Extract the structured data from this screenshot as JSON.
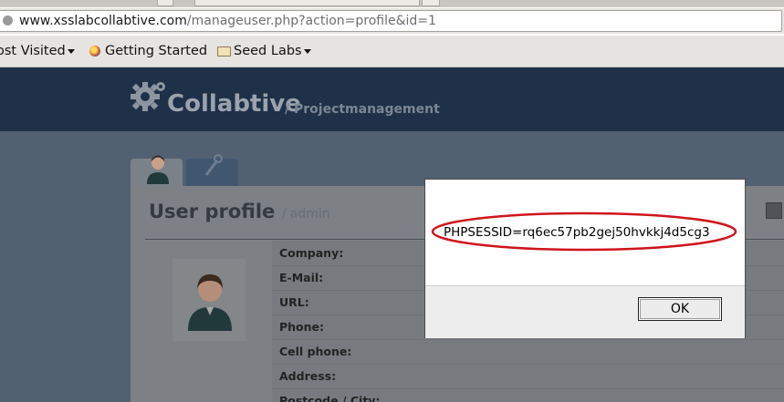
{
  "browser": {
    "url_host": "www.xsslabcollabtive.com",
    "url_path": "/manageuser.php?action=profile&id=1",
    "bookmarks": [
      {
        "label": "ost Visited",
        "icon": "none",
        "dropdown": true
      },
      {
        "label": "Getting Started",
        "icon": "firefox-icon",
        "dropdown": false
      },
      {
        "label": "Seed Labs",
        "icon": "folder-icon",
        "dropdown": true
      }
    ]
  },
  "app": {
    "name": "Collabtive",
    "tagline": "/ Projectmanagement",
    "header_color": "#1f3049"
  },
  "profile": {
    "title": "User profile",
    "subtitle": "/ admin",
    "fields": [
      "Company:",
      "E-Mail:",
      "URL:",
      "Phone:",
      "Cell phone:",
      "Address:",
      "Postcode / City:"
    ]
  },
  "dialog": {
    "message": "PHPSESSID=rq6ec57pb2gej50hvkkj4d5cg3",
    "ok_label": "OK",
    "highlight_color": "#d0141b"
  }
}
